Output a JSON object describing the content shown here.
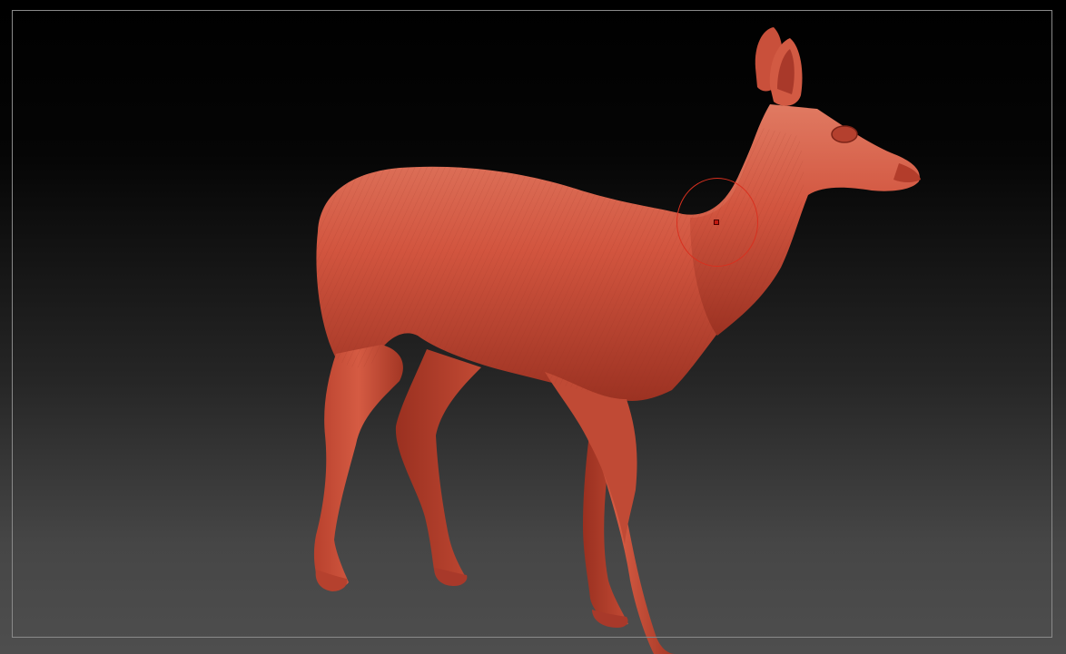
{
  "canvas": {
    "background_top": "#000000",
    "background_bottom": "#4e4e4e",
    "frame_color": "#8a8a8a"
  },
  "model": {
    "subject": "deer-sculpt",
    "material_color": "#d2553f",
    "shadow_color": "#8e2d20",
    "highlight_color": "#e77a62"
  },
  "cursor": {
    "icon": "brush-cursor-icon",
    "ring_color": "#d8301f"
  }
}
